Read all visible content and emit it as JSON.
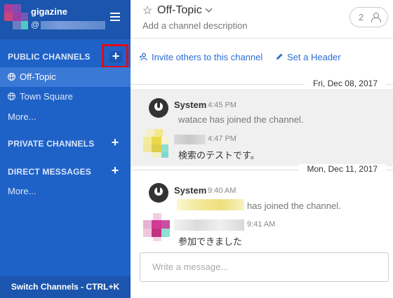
{
  "team": {
    "name": "gigazine",
    "user_prefix": "@"
  },
  "sidebar": {
    "public_title": "PUBLIC CHANNELS",
    "channels": [
      {
        "label": "Off-Topic",
        "active": true
      },
      {
        "label": "Town Square",
        "active": false
      }
    ],
    "public_more": "More...",
    "private_title": "PRIVATE CHANNELS",
    "direct_title": "DIRECT MESSAGES",
    "direct_more": "More...",
    "switch_label": "Switch Channels - CTRL+K",
    "plus": "+"
  },
  "header": {
    "star": "☆",
    "channel_name": "Off-Topic",
    "description": "Add a channel description",
    "member_count": "2"
  },
  "intro": {
    "invite": "Invite others to this channel",
    "set_header": "Set a Header"
  },
  "messages": {
    "date1": "Fri, Dec 08, 2017",
    "date2": "Mon, Dec 11, 2017",
    "post1": {
      "author": "System",
      "time": "4:45 PM",
      "text": "watace has joined the channel."
    },
    "post2": {
      "time": "4:47 PM",
      "text": "検索のテストです。"
    },
    "post3": {
      "author": "System",
      "time": "9:40 AM",
      "text": "has joined the channel."
    },
    "post4": {
      "time": "9:41 AM",
      "text": "参加できました"
    }
  },
  "composer": {
    "placeholder": "Write a message..."
  },
  "colors": {
    "sidebar": "#1f62c7",
    "sidebar_dark": "#1b55ad",
    "active": "#3a79d6",
    "link": "#2a6dd4",
    "highlight": "#e10b16"
  }
}
